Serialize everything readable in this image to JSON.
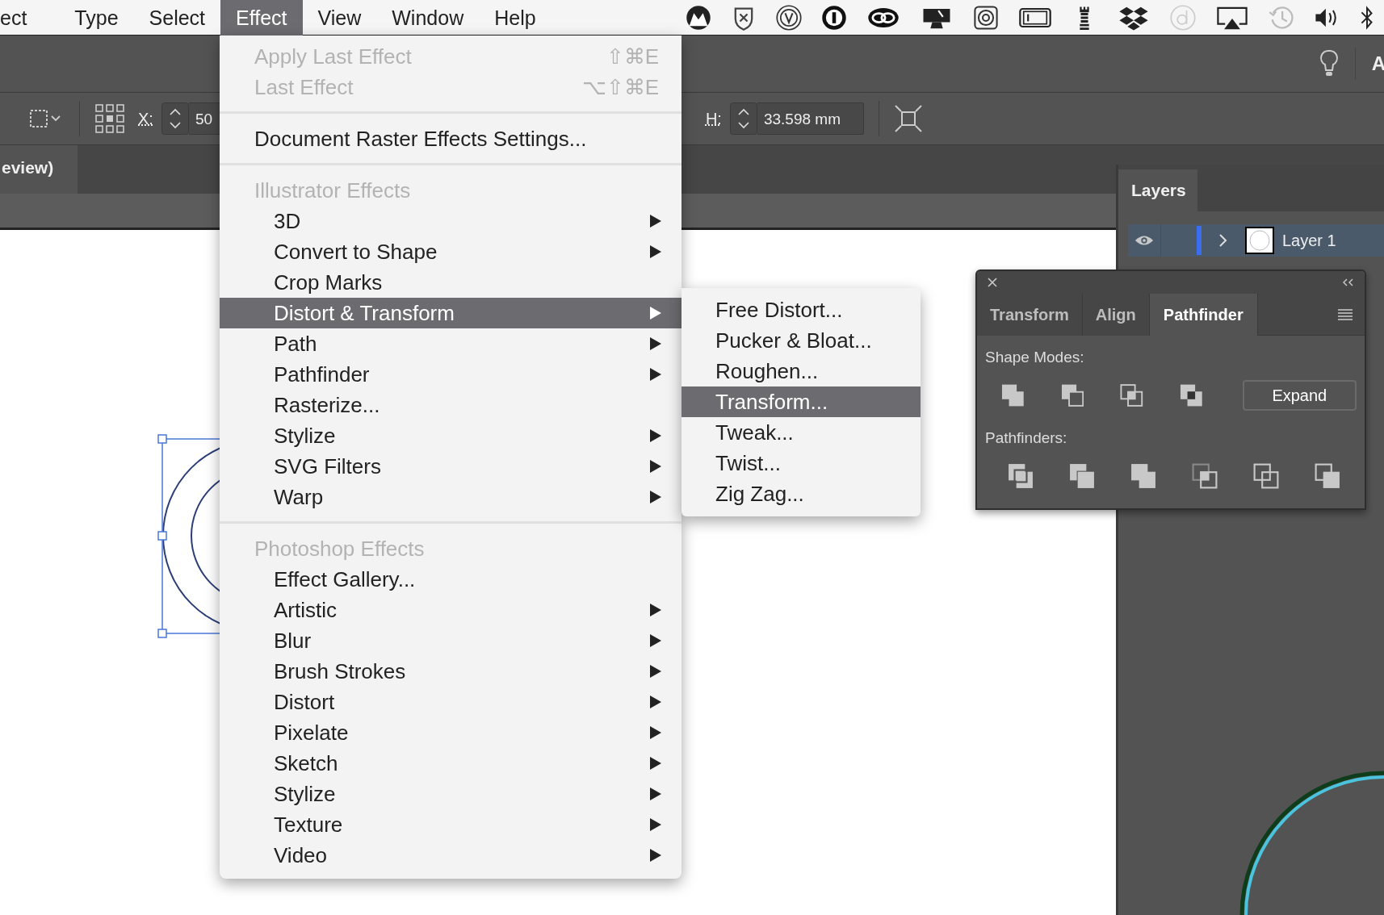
{
  "menu_bar": {
    "items": [
      {
        "label": "ect",
        "selected": false
      },
      {
        "label": "Type",
        "selected": false
      },
      {
        "label": "Select",
        "selected": false
      },
      {
        "label": "Effect",
        "selected": true
      },
      {
        "label": "View",
        "selected": false
      },
      {
        "label": "Window",
        "selected": false
      },
      {
        "label": "Help",
        "selected": false
      }
    ]
  },
  "app_bar": {
    "workspace": "A"
  },
  "control_bar": {
    "x_label": "X:",
    "x_value": "50",
    "h_label": "H:",
    "h_value": "33.598 mm"
  },
  "document_tab": {
    "title": "eview)"
  },
  "effect_menu": {
    "entries": [
      {
        "kind": "item",
        "label": "Apply Last Effect",
        "shortcut": "⇧⌘E",
        "submenu": false,
        "selected": false,
        "disabled": true
      },
      {
        "kind": "item",
        "label": "Last Effect",
        "shortcut": "⌥⇧⌘E",
        "submenu": false,
        "selected": false,
        "disabled": true
      },
      {
        "kind": "separator"
      },
      {
        "kind": "item",
        "label": "Document Raster Effects Settings...",
        "submenu": false,
        "selected": false,
        "disabled": false
      },
      {
        "kind": "separator"
      },
      {
        "kind": "group",
        "label": "Illustrator Effects",
        "children": [
          {
            "label": "3D",
            "submenu": true,
            "selected": false,
            "disabled": false
          },
          {
            "label": "Convert to Shape",
            "submenu": true,
            "selected": false,
            "disabled": false
          },
          {
            "label": "Crop Marks",
            "submenu": false,
            "selected": false,
            "disabled": false
          },
          {
            "label": "Distort & Transform",
            "submenu": true,
            "selected": true,
            "disabled": false
          },
          {
            "label": "Path",
            "submenu": true,
            "selected": false,
            "disabled": false
          },
          {
            "label": "Pathfinder",
            "submenu": true,
            "selected": false,
            "disabled": false
          },
          {
            "label": "Rasterize...",
            "submenu": false,
            "selected": false,
            "disabled": false
          },
          {
            "label": "Stylize",
            "submenu": true,
            "selected": false,
            "disabled": false
          },
          {
            "label": "SVG Filters",
            "submenu": true,
            "selected": false,
            "disabled": false
          },
          {
            "label": "Warp",
            "submenu": true,
            "selected": false,
            "disabled": false
          }
        ]
      },
      {
        "kind": "separator"
      },
      {
        "kind": "group",
        "label": "Photoshop Effects",
        "children": [
          {
            "label": "Effect Gallery...",
            "submenu": false,
            "selected": false,
            "disabled": false
          },
          {
            "label": "Artistic",
            "submenu": true,
            "selected": false,
            "disabled": false
          },
          {
            "label": "Blur",
            "submenu": true,
            "selected": false,
            "disabled": false
          },
          {
            "label": "Brush Strokes",
            "submenu": true,
            "selected": false,
            "disabled": false
          },
          {
            "label": "Distort",
            "submenu": true,
            "selected": false,
            "disabled": false
          },
          {
            "label": "Pixelate",
            "submenu": true,
            "selected": false,
            "disabled": false
          },
          {
            "label": "Sketch",
            "submenu": true,
            "selected": false,
            "disabled": false
          },
          {
            "label": "Stylize",
            "submenu": true,
            "selected": false,
            "disabled": false
          },
          {
            "label": "Texture",
            "submenu": true,
            "selected": false,
            "disabled": false
          },
          {
            "label": "Video",
            "submenu": true,
            "selected": false,
            "disabled": false
          }
        ]
      }
    ]
  },
  "submenu": {
    "items": [
      {
        "label": "Free Distort...",
        "selected": false
      },
      {
        "label": "Pucker & Bloat...",
        "selected": false
      },
      {
        "label": "Roughen...",
        "selected": false
      },
      {
        "label": "Transform...",
        "selected": true
      },
      {
        "label": "Tweak...",
        "selected": false
      },
      {
        "label": "Twist...",
        "selected": false
      },
      {
        "label": "Zig Zag...",
        "selected": false
      }
    ]
  },
  "layers_panel": {
    "tab": "Layers",
    "layers": [
      {
        "name": "Layer 1",
        "visible": true,
        "expanded": false,
        "selected": true
      }
    ]
  },
  "pathfinder_panel": {
    "tabs": [
      {
        "label": "Transform",
        "selected": false
      },
      {
        "label": "Align",
        "selected": false
      },
      {
        "label": "Pathfinder",
        "selected": true
      }
    ],
    "shape_modes_label": "Shape Modes:",
    "expand_button": "Expand",
    "pathfinders_label": "Pathfinders:"
  }
}
